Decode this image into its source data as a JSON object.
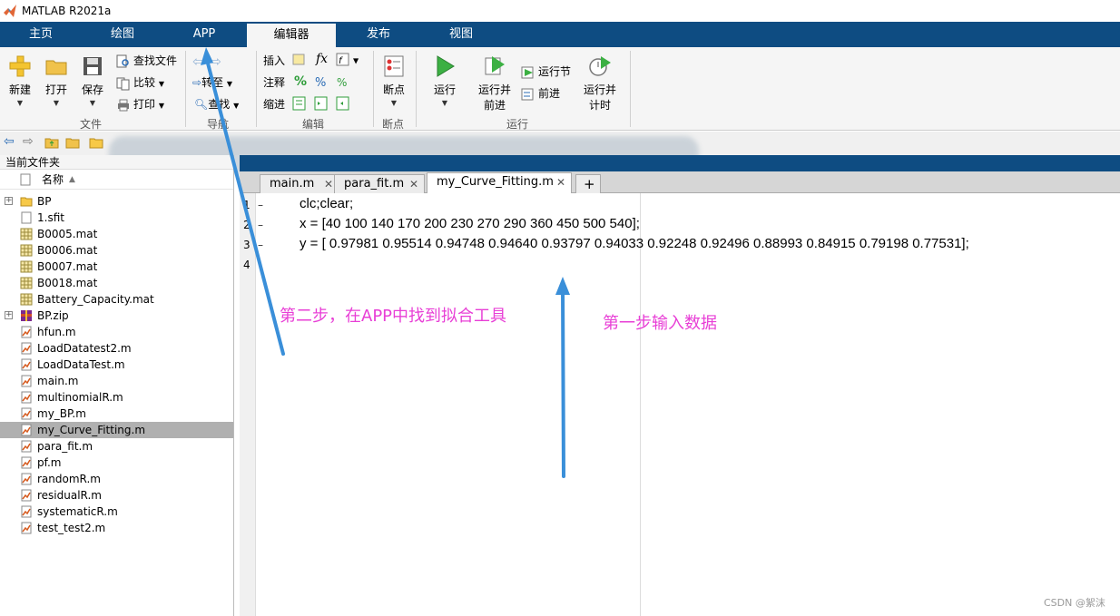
{
  "window": {
    "title": "MATLAB R2021a"
  },
  "ribbon_tabs": [
    "主页",
    "绘图",
    "APP",
    "编辑器",
    "发布",
    "视图"
  ],
  "ribbon": {
    "file_group": {
      "new": "新建",
      "open": "打开",
      "save": "保存",
      "find_files": "查找文件",
      "compare": "比较",
      "print": "打印",
      "name": "文件"
    },
    "nav_group": {
      "goto": "转至",
      "find": "查找",
      "name": "导航"
    },
    "edit_group": {
      "insert": "插入",
      "fx": "fx",
      "comment": "注释",
      "pct": "%",
      "indent": "缩进",
      "name": "编辑"
    },
    "breakpoint_group": {
      "breakpoint": "断点",
      "name": "断点"
    },
    "run_group": {
      "run": "运行",
      "run_advance_1": "运行并",
      "run_advance_2": "前进",
      "run_section": "运行节",
      "advance": "前进",
      "run_time_1": "运行并",
      "run_time_2": "计时",
      "name": "运行"
    }
  },
  "current_folder": {
    "title": "当前文件夹",
    "column_name": "名称",
    "files": [
      {
        "name": "BP",
        "icon": "folder-icon",
        "expandable": true
      },
      {
        "name": "1.sfit",
        "icon": "file-icon"
      },
      {
        "name": "B0005.mat",
        "icon": "mat-file-icon"
      },
      {
        "name": "B0006.mat",
        "icon": "mat-file-icon"
      },
      {
        "name": "B0007.mat",
        "icon": "mat-file-icon"
      },
      {
        "name": "B0018.mat",
        "icon": "mat-file-icon"
      },
      {
        "name": "Battery_Capacity.mat",
        "icon": "mat-file-icon"
      },
      {
        "name": "BP.zip",
        "icon": "zip-file-icon",
        "expandable": true
      },
      {
        "name": "hfun.m",
        "icon": "m-file-icon"
      },
      {
        "name": "LoadDatatest2.m",
        "icon": "m-file-icon"
      },
      {
        "name": "LoadDataTest.m",
        "icon": "m-file-icon"
      },
      {
        "name": "main.m",
        "icon": "m-file-icon"
      },
      {
        "name": "multinomialR.m",
        "icon": "m-file-icon"
      },
      {
        "name": "my_BP.m",
        "icon": "m-file-icon"
      },
      {
        "name": "my_Curve_Fitting.m",
        "icon": "m-file-icon",
        "selected": true
      },
      {
        "name": "para_fit.m",
        "icon": "m-file-icon"
      },
      {
        "name": "pf.m",
        "icon": "m-file-icon"
      },
      {
        "name": "randomR.m",
        "icon": "m-file-icon"
      },
      {
        "name": "residualR.m",
        "icon": "m-file-icon"
      },
      {
        "name": "systematicR.m",
        "icon": "m-file-icon"
      },
      {
        "name": "test_test2.m",
        "icon": "m-file-icon"
      }
    ]
  },
  "editor": {
    "tabs": [
      "main.m",
      "para_fit.m",
      "my_Curve_Fitting.m",
      "+"
    ],
    "active_tab": "my_Curve_Fitting.m",
    "lines": [
      {
        "num": "1",
        "marker": "–",
        "code": "clc;clear;"
      },
      {
        "num": "2",
        "marker": "–",
        "code": "x = [40 100 140 170 200 230 270 290 360 450 500 540];"
      },
      {
        "num": "3",
        "marker": "–",
        "code": "y = [ 0.97981 0.95514 0.94748 0.94640 0.93797 0.94033 0.92248 0.92496 0.88993 0.84915 0.79198 0.77531];"
      },
      {
        "num": "4",
        "marker": "",
        "code": ""
      }
    ]
  },
  "annotations": {
    "step2": "第二步，在APP中找到拟合工具",
    "step1": "第一步输入数据",
    "color": "#e83fd6"
  },
  "watermark": "CSDN @絮沫"
}
